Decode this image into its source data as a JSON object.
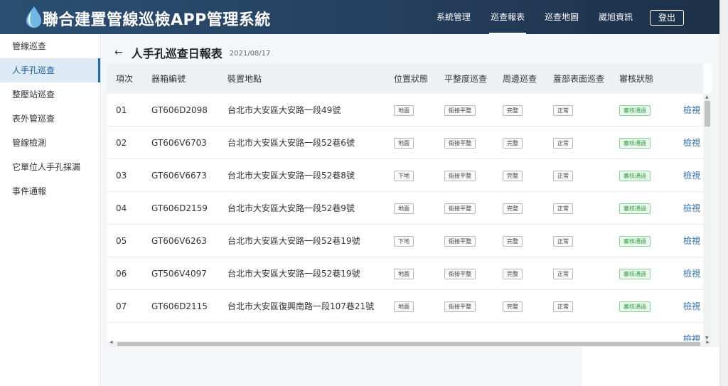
{
  "header": {
    "title": "聯合建置管線巡檢APP管理系統",
    "nav": [
      "系統管理",
      "巡查報表",
      "巡查地圖",
      "崴旭資訊"
    ],
    "active_nav": "巡查報表",
    "logout_label": "登出"
  },
  "sidebar": {
    "items": [
      {
        "label": "管線巡查",
        "active": false
      },
      {
        "label": "人手孔巡查",
        "active": true
      },
      {
        "label": "整壓站巡查",
        "active": false
      },
      {
        "label": "表外管巡查",
        "active": false
      },
      {
        "label": "管線檢測",
        "active": false
      },
      {
        "label": "它單位人手孔採漏",
        "active": false
      },
      {
        "label": "事件通報",
        "active": false
      }
    ]
  },
  "page": {
    "back_icon": "arrow-left-icon",
    "title": "人手孔巡查日報表",
    "date": "2021/08/17"
  },
  "table": {
    "headers": [
      "項次",
      "器箱編號",
      "裝置地點",
      "位置狀態",
      "平整度巡查",
      "周邊巡查",
      "蓋部表面巡查",
      "審核狀態"
    ],
    "rows": [
      {
        "no": "01",
        "box_id": "GT606D2098",
        "location": "台北市大安區大安路一段49號",
        "position": "地面",
        "flatness": "銜接平整",
        "surrounding": "完整",
        "cover_surface": "正常",
        "review": "審核通過",
        "action": "檢視"
      },
      {
        "no": "02",
        "box_id": "GT606V6703",
        "location": "台北市大安區大安路一段52巷6號",
        "position": "地面",
        "flatness": "銜接平整",
        "surrounding": "完整",
        "cover_surface": "正常",
        "review": "審核通過",
        "action": "檢視"
      },
      {
        "no": "03",
        "box_id": "GT606V6673",
        "location": "台北市大安區大安路一段52巷8號",
        "position": "下地",
        "flatness": "銜接平整",
        "surrounding": "完整",
        "cover_surface": "正常",
        "review": "審核通過",
        "action": "檢視"
      },
      {
        "no": "04",
        "box_id": "GT606D2159",
        "location": "台北市大安區大安路一段52巷9號",
        "position": "地面",
        "flatness": "銜接平整",
        "surrounding": "完整",
        "cover_surface": "正常",
        "review": "審核通過",
        "action": "檢視"
      },
      {
        "no": "05",
        "box_id": "GT606V6263",
        "location": "台北市大安區大安路一段52巷19號",
        "position": "下地",
        "flatness": "銜接平整",
        "surrounding": "完整",
        "cover_surface": "正常",
        "review": "審核通過",
        "action": "檢視"
      },
      {
        "no": "06",
        "box_id": "GT506V4097",
        "location": "台北市大安區大安路一段52巷19號",
        "position": "地面",
        "flatness": "銜接平整",
        "surrounding": "完整",
        "cover_surface": "正常",
        "review": "審核通過",
        "action": "檢視"
      },
      {
        "no": "07",
        "box_id": "GT606D2115",
        "location": "台北市大安區復興南路一段107巷21號",
        "position": "地面",
        "flatness": "銜接平整",
        "surrounding": "完整",
        "cover_surface": "正常",
        "review": "審核通過",
        "action": "檢視"
      },
      {
        "no": "",
        "box_id": "",
        "location": "",
        "position": "",
        "flatness": "",
        "surrounding": "",
        "cover_surface": "",
        "review": "",
        "action": "檢視"
      }
    ]
  },
  "colors": {
    "header_bg": "#253f5d",
    "accent": "#1f6bb0",
    "approved_green": "#2f9e44",
    "link_blue": "#2f6fb2"
  }
}
